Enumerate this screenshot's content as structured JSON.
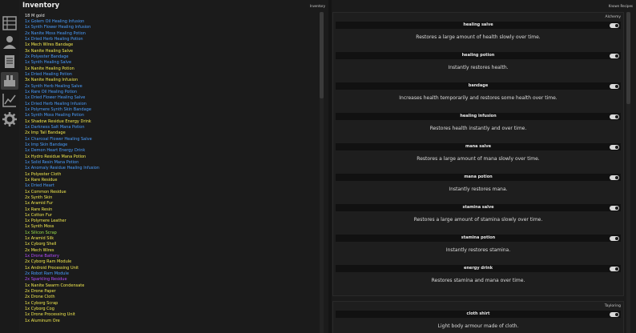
{
  "inventory": {
    "title": "Inventory",
    "header_label": "Inventory",
    "gold": "18 M gold",
    "items": [
      {
        "text": "1x Golem Oil Healing Infusion",
        "color": "#4a9eff"
      },
      {
        "text": "1x Synth Flower Healing Infusion",
        "color": "#4a9eff"
      },
      {
        "text": "2x Nanite Moss Healing Potion",
        "color": "#4a9eff"
      },
      {
        "text": "1x Dried Herb Healing Potion",
        "color": "#4a9eff"
      },
      {
        "text": "1x Mech Wires Bandage",
        "color": "#f2e94e"
      },
      {
        "text": "3x Nanite Healing Salve",
        "color": "#f2e94e"
      },
      {
        "text": "2x Polyester Bandage",
        "color": "#4a9eff"
      },
      {
        "text": "1x Synth Healing Salve",
        "color": "#4a9eff"
      },
      {
        "text": "1x Nanite Healing Potion",
        "color": "#f2e94e"
      },
      {
        "text": "1x Dried Healing Potion",
        "color": "#4a9eff"
      },
      {
        "text": "3x Nanite Healing Infusion",
        "color": "#f2e94e"
      },
      {
        "text": "2x Synth Herb Healing Salve",
        "color": "#4a9eff"
      },
      {
        "text": "1x Rare Oil Healing Potion",
        "color": "#4a9eff"
      },
      {
        "text": "1x Dried Flower Healing Salve",
        "color": "#4a9eff"
      },
      {
        "text": "1x Dried Herb Healing Infusion",
        "color": "#4a9eff"
      },
      {
        "text": "1x Polymere Synth Skin Bandage",
        "color": "#4a9eff"
      },
      {
        "text": "1x Synth Moss Healing Potion",
        "color": "#4a9eff"
      },
      {
        "text": "1x Shadow Residue Energy Drink",
        "color": "#f2e94e"
      },
      {
        "text": "1x Darkness Salt Mana Potion",
        "color": "#4a9eff"
      },
      {
        "text": "2x Imp Tail Bandage",
        "color": "#f2e94e"
      },
      {
        "text": "1x Charcoal Flower Healing Salve",
        "color": "#4a9eff"
      },
      {
        "text": "1x Imp Skin Bandage",
        "color": "#4a9eff"
      },
      {
        "text": "1x Demon Heart Energy Drink",
        "color": "#4a9eff"
      },
      {
        "text": "1x Hydro Residue Mana Potion",
        "color": "#f2e94e"
      },
      {
        "text": "1x Solid Resin Mana Potion",
        "color": "#4a9eff"
      },
      {
        "text": "1x Anomaly Residue Healing Infusion",
        "color": "#4a9eff"
      },
      {
        "text": "1x Polyester Cloth",
        "color": "#f2e94e"
      },
      {
        "text": "1x Rare Residue",
        "color": "#f2e94e"
      },
      {
        "text": "1x Dried Heart",
        "color": "#4a9eff"
      },
      {
        "text": "1x Common Residue",
        "color": "#f2e94e"
      },
      {
        "text": "2x Synth Skin",
        "color": "#f2e94e"
      },
      {
        "text": "1x Aramid Fur",
        "color": "#f2e94e"
      },
      {
        "text": "1x Rare Resin",
        "color": "#f2e94e"
      },
      {
        "text": "1x Cotton Fur",
        "color": "#f2e94e"
      },
      {
        "text": "1x Polymere Leather",
        "color": "#f2e94e"
      },
      {
        "text": "1x Synth Moss",
        "color": "#f2e94e"
      },
      {
        "text": "1x Silicon Scrap",
        "color": "#9be04a"
      },
      {
        "text": "1x Aramid Silk",
        "color": "#f2e94e"
      },
      {
        "text": "1x Cyborg Shell",
        "color": "#f2e94e"
      },
      {
        "text": "2x Mech Wires",
        "color": "#f2e94e"
      },
      {
        "text": "1x Drone Battery",
        "color": "#b24cff"
      },
      {
        "text": "2x Cyborg Ram Module",
        "color": "#f2e94e"
      },
      {
        "text": "1x Android Processing Unit",
        "color": "#f2e94e"
      },
      {
        "text": "2x Robot Ram Module",
        "color": "#4a9eff"
      },
      {
        "text": "2x Sparkling Residue",
        "color": "#b24cff"
      },
      {
        "text": "1x Nanite Swarm Condensate",
        "color": "#f2e94e"
      },
      {
        "text": "2x Drone Paper",
        "color": "#f2e94e"
      },
      {
        "text": "2x Drone Cloth",
        "color": "#f2e94e"
      },
      {
        "text": "1x Cyborg Scrap",
        "color": "#f2e94e"
      },
      {
        "text": "1x Cyborg Cog",
        "color": "#f2e94e"
      },
      {
        "text": "1x Drone Processing Unit",
        "color": "#f2e94e"
      },
      {
        "text": "1x Aluminum Ore",
        "color": "#f2e94e"
      }
    ]
  },
  "recipes": {
    "header_label": "Known Recipes",
    "categories": [
      {
        "title": "Alchemy",
        "recipes": [
          {
            "name": "healing salve",
            "desc": "Restores a large amount of health slowly over time."
          },
          {
            "name": "healing potion",
            "desc": "Instantly restores health."
          },
          {
            "name": "bandage",
            "desc": "Increases health temporarily and restores some health over time."
          },
          {
            "name": "healing infusion",
            "desc": "Restores health instantly and over time."
          },
          {
            "name": "mana salve",
            "desc": "Restores a large amount of mana slowly over time."
          },
          {
            "name": "mana potion",
            "desc": "Instantly restores mana."
          },
          {
            "name": "stamina salve",
            "desc": "Restores a large amount of stamina slowly over time."
          },
          {
            "name": "stamina potion",
            "desc": "Instantly restores stamina."
          },
          {
            "name": "energy drink",
            "desc": "Restores stamina and mana over time."
          }
        ]
      },
      {
        "title": "Tayloring",
        "recipes": [
          {
            "name": "cloth shirt",
            "desc": "Light body armour made of cloth."
          }
        ]
      }
    ]
  },
  "sidebar": {
    "items": [
      {
        "icon": "inventory-grid-icon"
      },
      {
        "icon": "character-icon"
      },
      {
        "icon": "quest-scroll-icon"
      },
      {
        "icon": "crafting-icon"
      },
      {
        "icon": "stats-chart-icon"
      },
      {
        "icon": "settings-gear-icon"
      }
    ]
  }
}
